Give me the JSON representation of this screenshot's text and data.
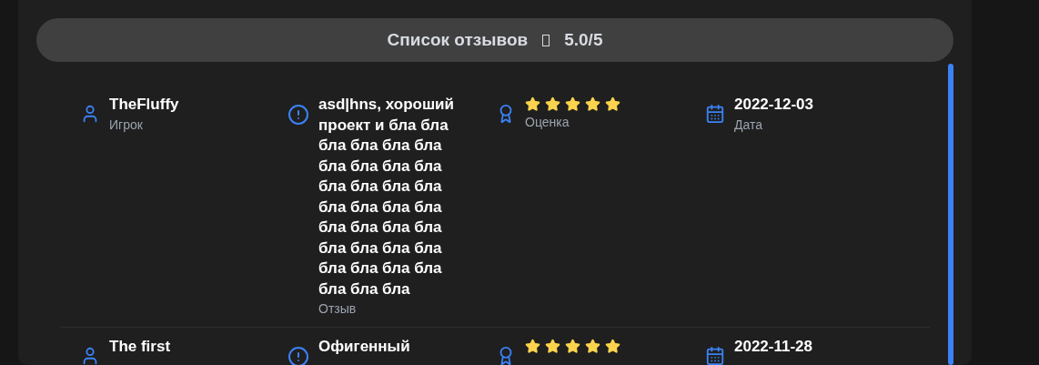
{
  "header": {
    "title": "Список отзывов",
    "rating": "5.0/5"
  },
  "reviews": [
    {
      "player": "TheFluffy",
      "player_label": "Игрок",
      "text": "asd|hns, хороший проект и бла бла бла бла бла бла бла бла бла бла бла бла бла бла бла бла бла бла бла бла бла бла бла бла бла бла бла бла бла бла бла бла бла",
      "text_label": "Отзыв",
      "stars": 5,
      "rating_label": "Оценка",
      "date": "2022-12-03",
      "date_label": "Дата"
    },
    {
      "player": "The first",
      "text": "Офигенный",
      "stars": 5,
      "date": "2022-11-28"
    }
  ]
}
